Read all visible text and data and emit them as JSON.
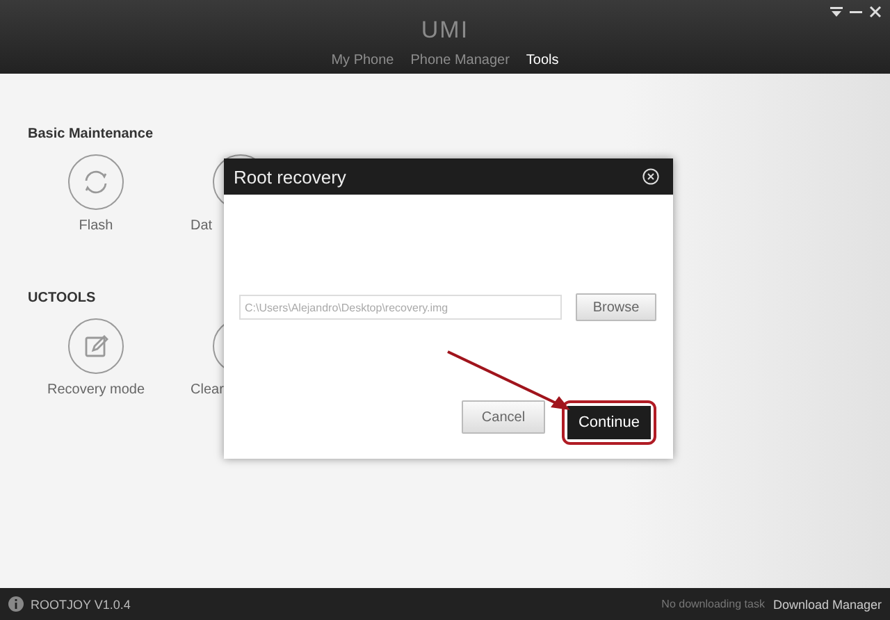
{
  "window": {
    "logo": "UMI"
  },
  "tabs": [
    {
      "label": "My Phone",
      "selected": false
    },
    {
      "label": "Phone Manager",
      "selected": false
    },
    {
      "label": "Tools",
      "selected": true
    }
  ],
  "sections": [
    {
      "title": "Basic Maintenance",
      "tiles": [
        {
          "label": "Flash",
          "kind": "sync"
        },
        {
          "label": "Dat",
          "kind": "plain"
        }
      ]
    },
    {
      "title": "UCTOOLS",
      "tiles": [
        {
          "label": "Recovery mode",
          "kind": "edit"
        },
        {
          "label": "Clear",
          "kind": "plain"
        }
      ]
    }
  ],
  "dialog": {
    "title": "Root recovery",
    "path": "C:\\Users\\Alejandro\\Desktop\\recovery.img",
    "browse": "Browse",
    "cancel": "Cancel",
    "continue": "Continue"
  },
  "status_bar": {
    "version": "ROOTJOY V1.0.4",
    "task": "No downloading task",
    "manager": "Download Manager"
  }
}
